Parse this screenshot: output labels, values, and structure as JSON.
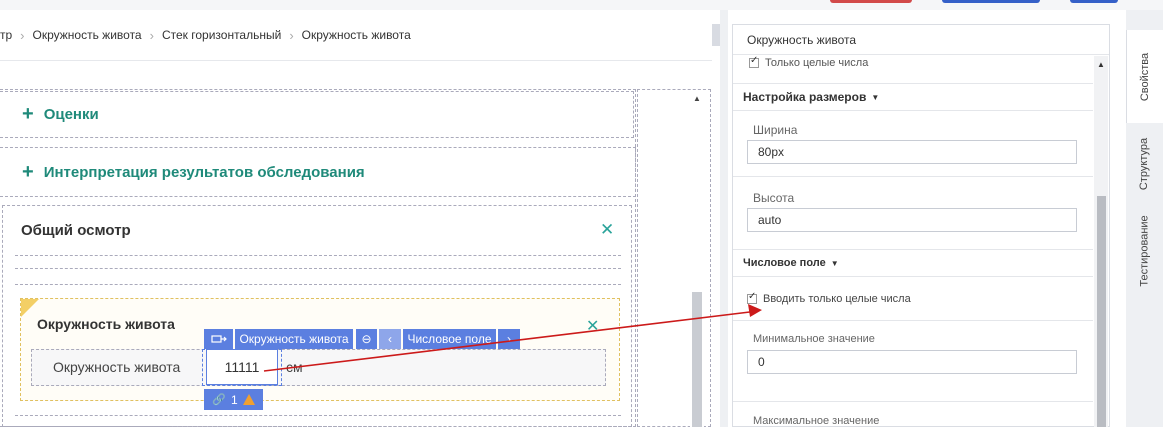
{
  "breadcrumb": [
    "тр",
    "Окружность живота",
    "Стек горизонтальный",
    "Окружность живота"
  ],
  "canvas": {
    "sections": [
      {
        "label": "Оценки"
      },
      {
        "label": "Интерпретация результатов обследования"
      }
    ],
    "group_title": "Общий осмотр",
    "item_title": "Окружность живота",
    "field_label": "Окружность живота",
    "field_value": "11111",
    "unit": "см",
    "toolbar": {
      "element_name": "Окружность живота",
      "element_type": "Числовое поле",
      "link_count": "1"
    }
  },
  "panel": {
    "title": "Окружность живота",
    "only_integers_top": "Только целые числа",
    "size_section": "Настройка размеров",
    "width_label": "Ширина",
    "width_value": "80px",
    "height_label": "Высота",
    "height_value": "auto",
    "numeric_section": "Числовое поле",
    "only_integers": "Вводить только целые числа",
    "min_label": "Минимальное значение",
    "min_value": "0",
    "max_label": "Максимальное значение"
  },
  "tabs": [
    "Свойства",
    "Структура",
    "Тестирование"
  ],
  "colors": {
    "accent": "#5b7fe0",
    "teal": "#1f8a7a",
    "arrow": "#cc1a1a",
    "warning": "#f0a030"
  }
}
